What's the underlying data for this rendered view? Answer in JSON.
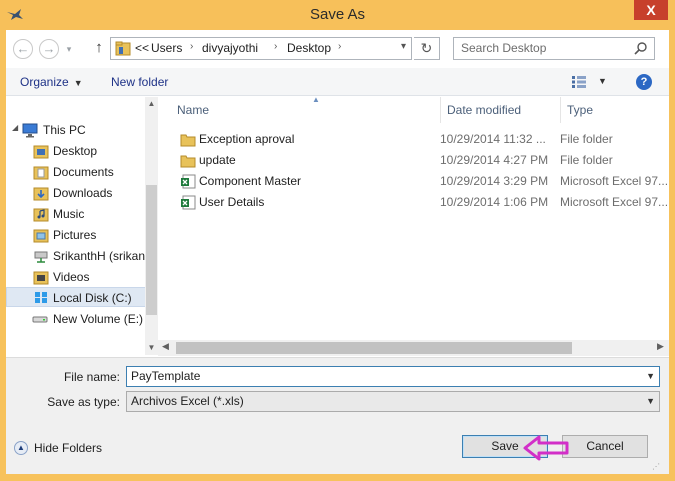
{
  "window": {
    "title": "Save As",
    "close_label": "X"
  },
  "nav": {
    "back_label": "←",
    "forward_label": "→",
    "up_label": "↑"
  },
  "address": {
    "crumbs": [
      "<<",
      "Users",
      "divyajyothi",
      "Desktop"
    ],
    "refresh_label": "↻"
  },
  "search": {
    "placeholder": "Search Desktop"
  },
  "toolbar": {
    "organize_label": "Organize",
    "new_folder_label": "New folder",
    "help_label": "?"
  },
  "sidebar": {
    "items": [
      {
        "label": "This PC",
        "icon": "this-pc-icon"
      },
      {
        "label": "Desktop",
        "icon": "desktop-folder-icon"
      },
      {
        "label": "Documents",
        "icon": "documents-folder-icon"
      },
      {
        "label": "Downloads",
        "icon": "downloads-folder-icon"
      },
      {
        "label": "Music",
        "icon": "music-folder-icon"
      },
      {
        "label": "Pictures",
        "icon": "pictures-folder-icon"
      },
      {
        "label": "SrikanthH (srikan",
        "icon": "network-drive-icon"
      },
      {
        "label": "Videos",
        "icon": "videos-folder-icon"
      },
      {
        "label": "Local Disk (C:)",
        "icon": "local-disk-icon",
        "selected": true
      },
      {
        "label": "New Volume (E:)",
        "icon": "drive-icon"
      }
    ]
  },
  "file_list": {
    "columns": [
      "Name",
      "Date modified",
      "Type"
    ],
    "rows": [
      {
        "name": "Exception aproval",
        "date": "10/29/2014 11:32 ...",
        "type": "File folder",
        "icon": "folder-icon"
      },
      {
        "name": "update",
        "date": "10/29/2014 4:27 PM",
        "type": "File folder",
        "icon": "folder-icon"
      },
      {
        "name": "Component Master",
        "date": "10/29/2014 3:29 PM",
        "type": "Microsoft Excel 97...",
        "icon": "excel-file-icon"
      },
      {
        "name": "User Details",
        "date": "10/29/2014 1:06 PM",
        "type": "Microsoft Excel 97...",
        "icon": "excel-file-icon"
      }
    ]
  },
  "form": {
    "file_name_label": "File name:",
    "file_name_value": "PayTemplate",
    "save_type_label": "Save as type:",
    "save_type_value": "Archivos Excel (*.xls)",
    "hide_folders_label": "Hide Folders",
    "save_label": "Save",
    "cancel_label": "Cancel"
  },
  "colors": {
    "title_bar": "#f7c05a",
    "close_button": "#c7402c",
    "annotation_arrow": "#d22fc8",
    "folder": "#e8c25a"
  }
}
